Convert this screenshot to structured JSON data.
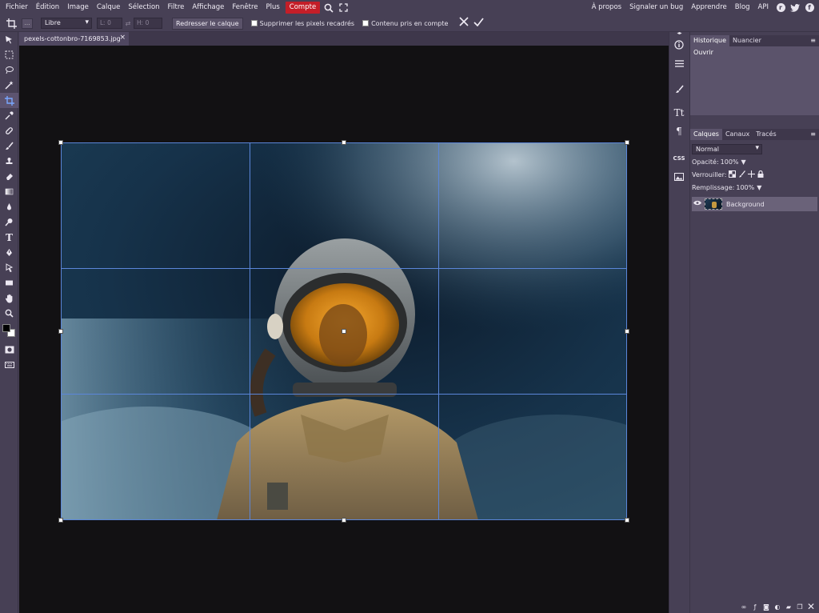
{
  "menubar": {
    "items": [
      "Fichier",
      "Édition",
      "Image",
      "Calque",
      "Sélection",
      "Filtre",
      "Affichage",
      "Fenêtre",
      "Plus",
      "Compte"
    ],
    "right_links": [
      "À propos",
      "Signaler un bug",
      "Apprendre",
      "Blog",
      "API"
    ],
    "social": [
      "reddit-icon",
      "twitter-icon",
      "facebook-icon"
    ]
  },
  "options": {
    "ratio_value": "Libre",
    "width_label": "Lː",
    "width_value": "0",
    "height_label": "Hː",
    "height_value": "0",
    "straighten_label": "Redresser le calque",
    "delete_cropped_label": "Supprimer les pixels recadrés",
    "content_aware_label": "Contenu pris en compte"
  },
  "document": {
    "tab_name": "pexels-cottonbro-7169853.jpg"
  },
  "history_panel": {
    "tabs": [
      "Historique",
      "Nuancier"
    ],
    "items": [
      "Ouvrir"
    ]
  },
  "layers_panel": {
    "tabs": [
      "Calques",
      "Canaux",
      "Tracés"
    ],
    "blend_mode": "Normal",
    "opacity_label": "Opacité:",
    "opacity_value": "100%",
    "lock_label": "Verrouiller:",
    "fill_label": "Remplissage:",
    "fill_value": "100%",
    "layers": [
      {
        "name": "Background"
      }
    ]
  },
  "iconcol": {
    "css_label": "CSS"
  },
  "colors": {
    "accent_compte": "#c41e28",
    "crop_grid": "#5b86d9",
    "foreground": "#000000",
    "background": "#ffffff"
  }
}
